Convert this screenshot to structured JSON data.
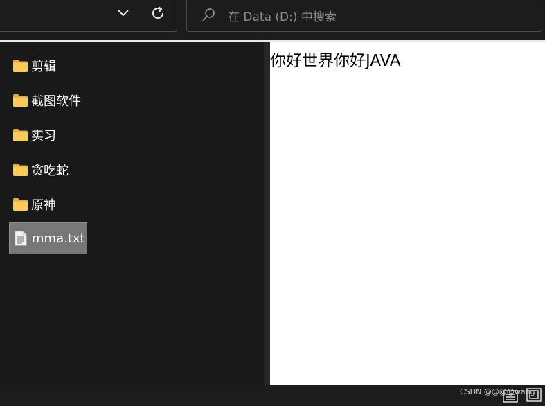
{
  "toolbar": {
    "search_placeholder": "在 Data (D:) 中搜索"
  },
  "nav": {
    "items": [
      {
        "label": "剪辑",
        "icon": "folder-icon",
        "selected": false
      },
      {
        "label": "截图软件",
        "icon": "folder-icon",
        "selected": false
      },
      {
        "label": "实习",
        "icon": "folder-icon",
        "selected": false
      },
      {
        "label": "贪吃蛇",
        "icon": "folder-icon",
        "selected": false
      },
      {
        "label": "原神",
        "icon": "folder-icon",
        "selected": false
      },
      {
        "label": "mma.txt",
        "icon": "text-file-icon",
        "selected": true
      }
    ]
  },
  "preview": {
    "content": "你好世界你好JAVA"
  },
  "status": {
    "watermark": "CSDN @@@@wang"
  },
  "colors": {
    "background": "#1c1c1c",
    "folder": "#f7c64b",
    "selection": "#777777"
  }
}
